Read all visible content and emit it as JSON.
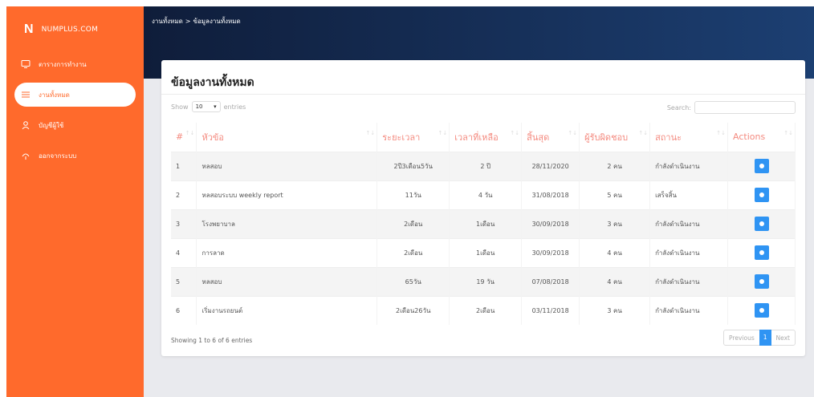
{
  "brand": {
    "logo": "N",
    "name": "NUMPLUS.COM"
  },
  "sidebar": {
    "items": [
      {
        "label": "ตารางการทำงาน",
        "icon": "monitor-icon"
      },
      {
        "label": "งานทั้งหมด",
        "icon": "list-icon"
      },
      {
        "label": "บัญชีผู้ใช้",
        "icon": "user-icon"
      },
      {
        "label": "ออกจากระบบ",
        "icon": "logout-icon"
      }
    ]
  },
  "breadcrumb": {
    "parent": "งานทั้งหมด",
    "sep": ">",
    "current": "ข้อมูลงานทั้งหมด"
  },
  "card": {
    "title": "ข้อมูลงานทั้งหมด"
  },
  "controls": {
    "show_label": "Show",
    "page_size": "10",
    "entries_label": "entries",
    "search_label": "Search:"
  },
  "table": {
    "headers": [
      "#",
      "หัวข้อ",
      "ระยะเวลา",
      "เวลาที่เหลือ",
      "สิ้นสุด",
      "ผู้รับผิดชอบ",
      "สถานะ",
      "Actions"
    ],
    "rows": [
      {
        "no": "1",
        "title": "หลสอบ",
        "duration": "2ปี3เดือน5วัน",
        "remaining": "2 ปี",
        "end": "28/11/2020",
        "staff": "2 คน",
        "status": "กำลังดำเนินงาน"
      },
      {
        "no": "2",
        "title": "หลสอบระบบ weekly report",
        "duration": "11วัน",
        "remaining": "4 วัน",
        "end": "31/08/2018",
        "staff": "5 คน",
        "status": "เสร็จสิ้น"
      },
      {
        "no": "3",
        "title": "โรงพยาบาล",
        "duration": "2เดือน",
        "remaining": "1เดือน",
        "end": "30/09/2018",
        "staff": "3 คน",
        "status": "กำลังดำเนินงาน"
      },
      {
        "no": "4",
        "title": "การลาด",
        "duration": "2เดือน",
        "remaining": "1เดือน",
        "end": "30/09/2018",
        "staff": "4 คน",
        "status": "กำลังดำเนินงาน"
      },
      {
        "no": "5",
        "title": "หลสอบ",
        "duration": "65วัน",
        "remaining": "19 วัน",
        "end": "07/08/2018",
        "staff": "4 คน",
        "status": "กำลังดำเนินงาน"
      },
      {
        "no": "6",
        "title": "เริ่มงานรถยนต์",
        "duration": "2เดือน26วัน",
        "remaining": "2เดือน",
        "end": "03/11/2018",
        "staff": "3 คน",
        "status": "กำลังดำเนินงาน"
      }
    ]
  },
  "footer": {
    "info": "Showing 1 to 6 of 6 entries",
    "prev": "Previous",
    "page": "1",
    "next": "Next"
  },
  "colors": {
    "sidebar": "#ff6a2c",
    "header": "#0f1d3a",
    "accent": "#2f94f3",
    "th_text": "#f48a7f"
  }
}
